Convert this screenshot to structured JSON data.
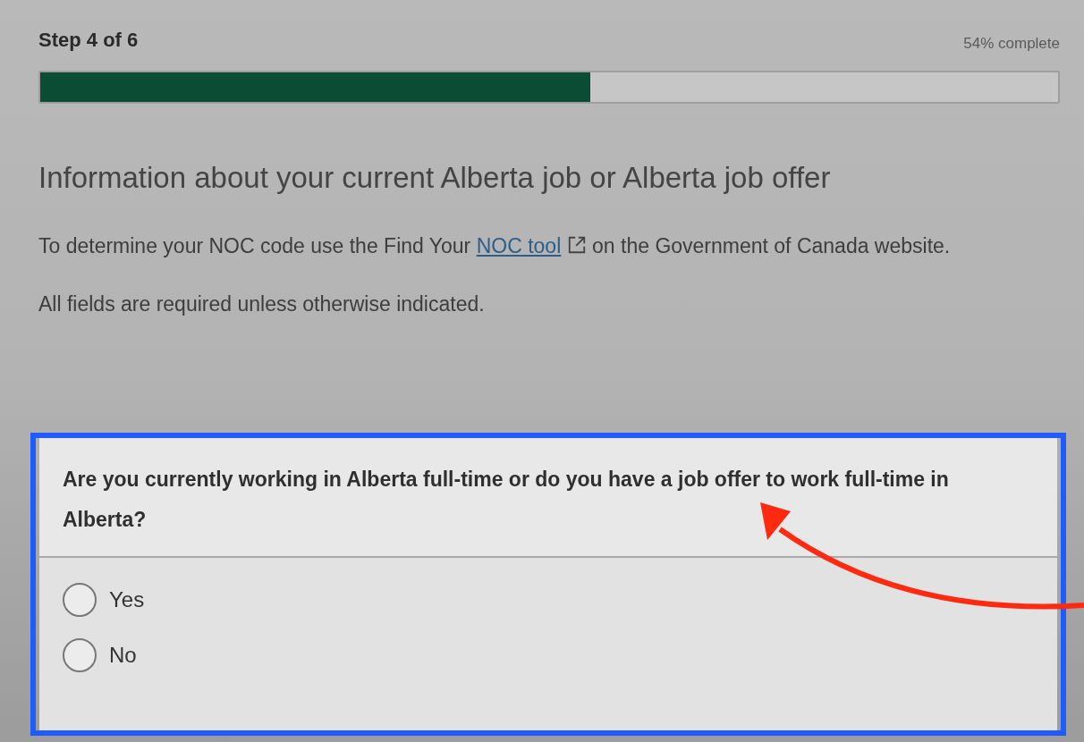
{
  "progress": {
    "step": "Step 4 of 6",
    "percent_label": "54% complete",
    "level": 0.54
  },
  "heading": "Information about your current Alberta job or Alberta job offer",
  "intro": {
    "before": "To determine your NOC code use the Find Your",
    "link": "NOC tool",
    "after": "on the Government of Canada website."
  },
  "required_note": "All fields are required unless otherwise indicated.",
  "question": {
    "text": "Are you currently working in Alberta full-time or do you have a job offer to work full-time in Alberta?",
    "options": [
      {
        "label": "Yes",
        "selected": false
      },
      {
        "label": "No",
        "selected": false
      }
    ]
  }
}
